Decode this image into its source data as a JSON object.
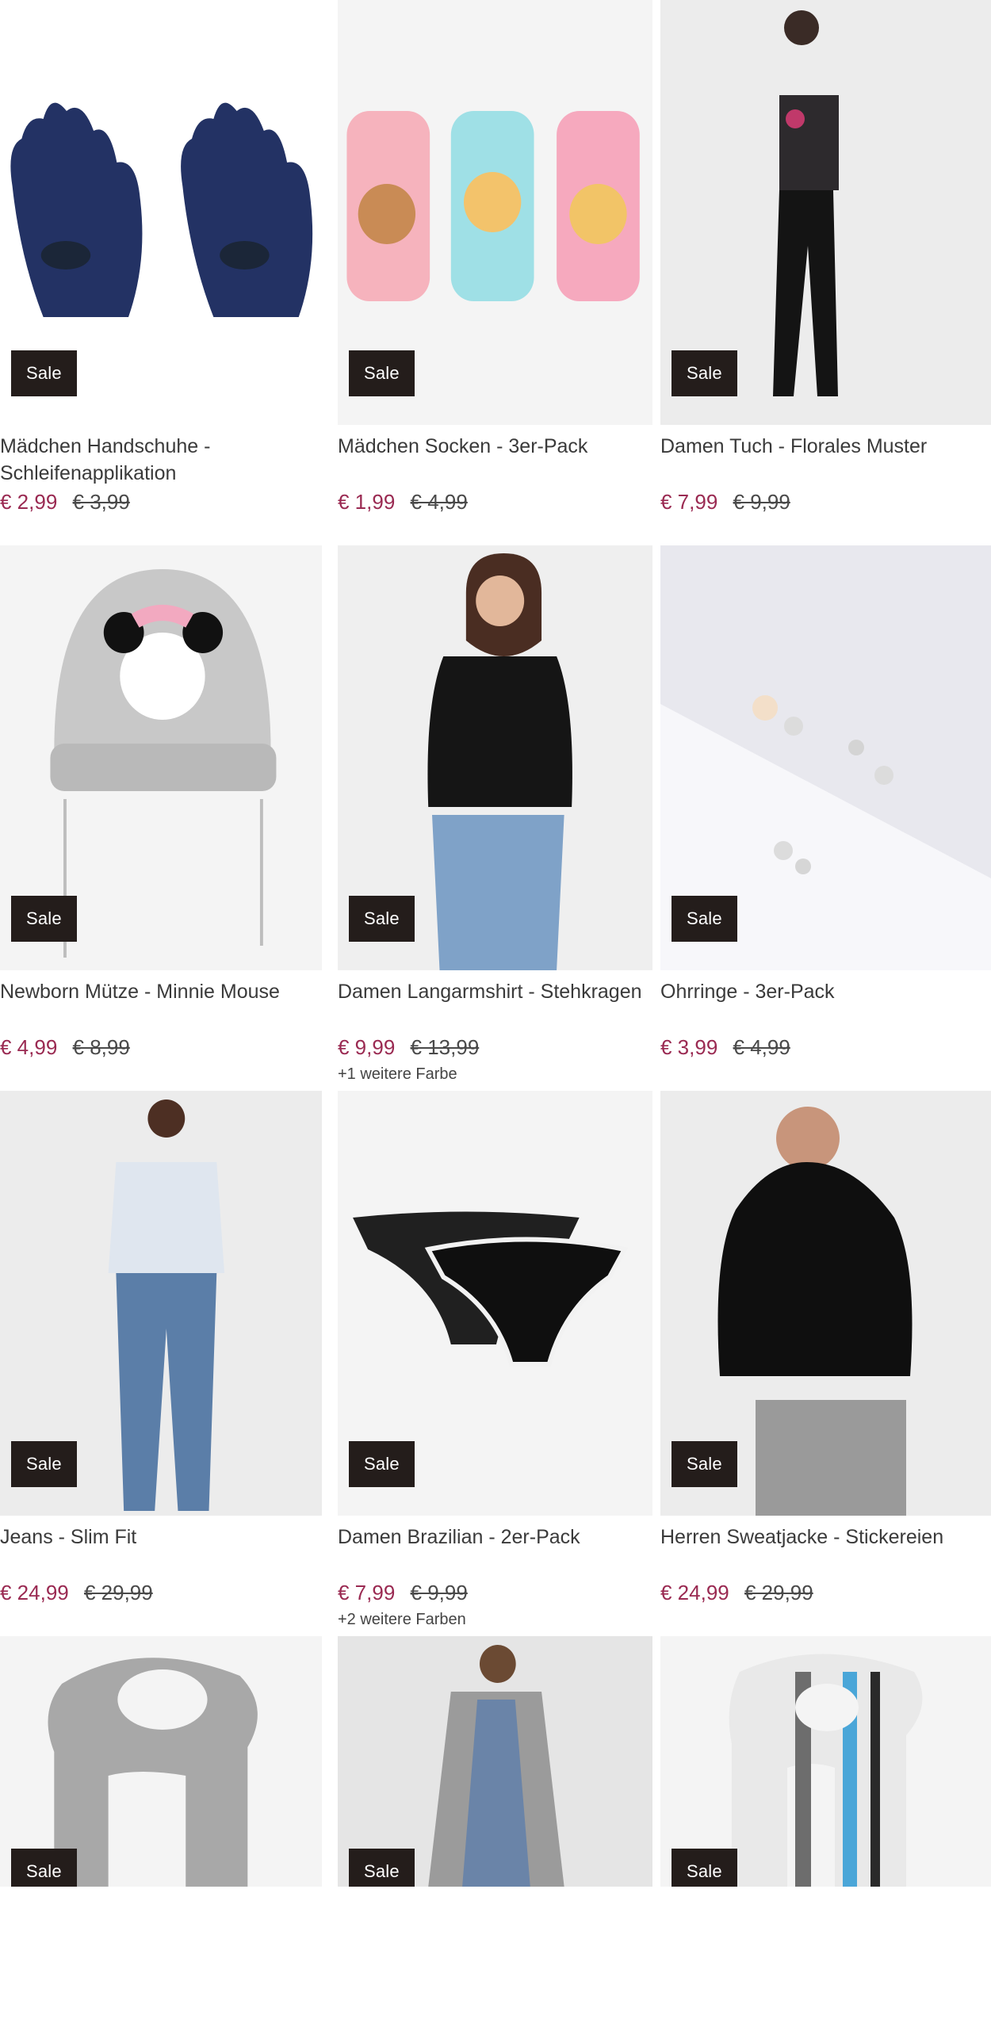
{
  "colors": {
    "sale_badge_bg": "#241d1b",
    "price": "#9a2a52",
    "old_price": "#4a4a4a"
  },
  "sale_label": "Sale",
  "products": [
    {
      "title": "Mädchen Handschuhe - Schleifenapplikation",
      "price": "€ 2,99",
      "old_price": "€ 3,99",
      "colors": "",
      "image": "gloves",
      "bg": "#ffffff"
    },
    {
      "title": "Mädchen Socken - 3er-Pack",
      "price": "€ 1,99",
      "old_price": "€ 4,99",
      "colors": "",
      "image": "socks",
      "bg": "#f4f4f4"
    },
    {
      "title": "Damen Tuch - Florales Muster",
      "price": "€ 7,99",
      "old_price": "€ 9,99",
      "colors": "",
      "image": "woman-top",
      "bg": "#ececec"
    },
    {
      "title": "Newborn Mütze - Minnie Mouse",
      "price": "€ 4,99",
      "old_price": "€ 8,99",
      "colors": "",
      "image": "beanie",
      "bg": "#f4f4f4"
    },
    {
      "title": "Damen Langarmshirt - Stehkragen",
      "price": "€ 9,99",
      "old_price": "€ 13,99",
      "colors": "+1 weitere Farbe",
      "image": "woman-shirt",
      "bg": "#efefef"
    },
    {
      "title": "Ohrringe - 3er-Pack",
      "price": "€ 3,99",
      "old_price": "€ 4,99",
      "colors": "",
      "image": "earrings",
      "bg": "#e8e8ee"
    },
    {
      "title": "Jeans - Slim Fit",
      "price": "€ 24,99",
      "old_price": "€ 29,99",
      "colors": "",
      "image": "woman-jeans",
      "bg": "#ececec"
    },
    {
      "title": "Damen Brazilian - 2er-Pack",
      "price": "€ 7,99",
      "old_price": "€ 9,99",
      "colors": "+2 weitere Farben",
      "image": "briefs",
      "bg": "#f4f4f4"
    },
    {
      "title": "Herren Sweatjacke - Stickereien",
      "price": "€ 24,99",
      "old_price": "€ 29,99",
      "colors": "",
      "image": "man-hoodie",
      "bg": "#ececec"
    },
    {
      "title": "",
      "price": "",
      "old_price": "",
      "colors": "",
      "image": "grey-scarf",
      "bg": "#f4f4f4"
    },
    {
      "title": "",
      "price": "",
      "old_price": "",
      "colors": "",
      "image": "woman-cardigan",
      "bg": "#e5e5e5"
    },
    {
      "title": "",
      "price": "",
      "old_price": "",
      "colors": "",
      "image": "check-scarf",
      "bg": "#f4f4f4"
    }
  ]
}
